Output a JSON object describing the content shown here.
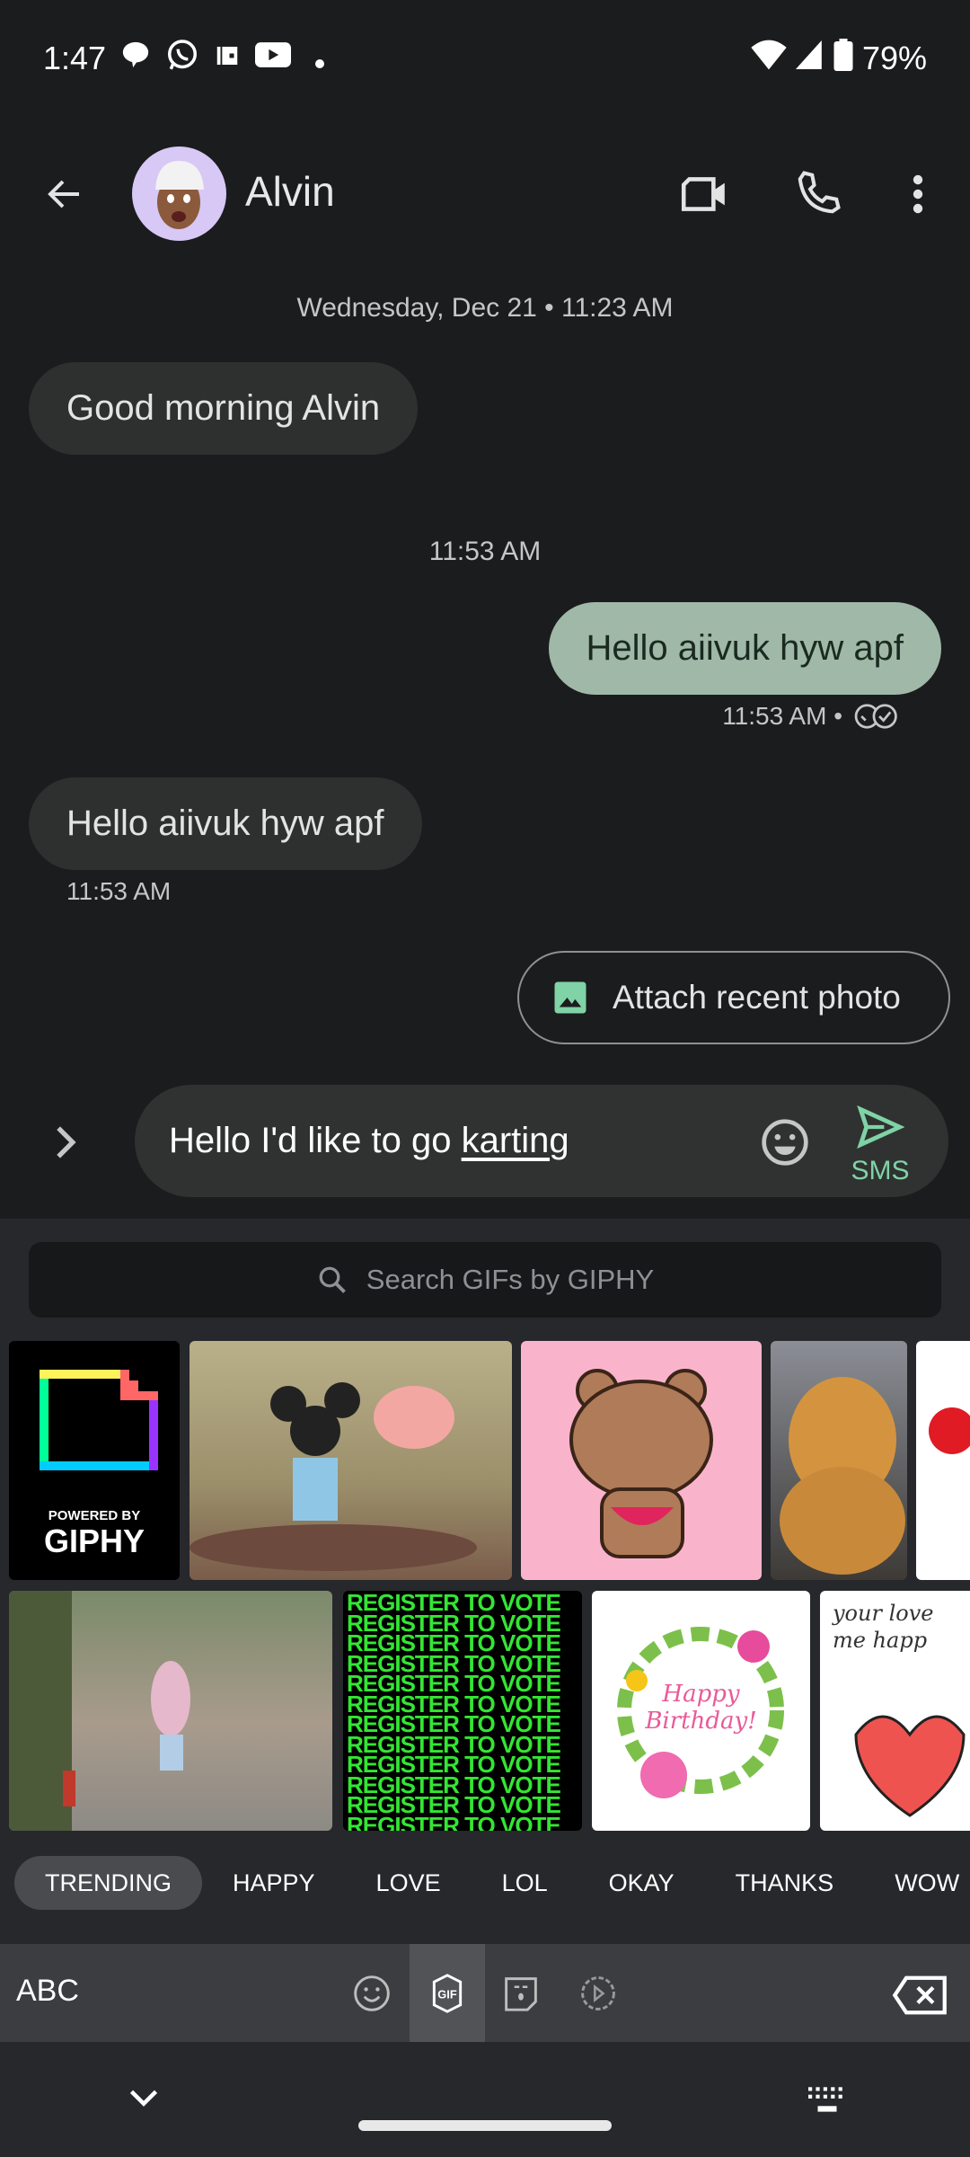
{
  "status_bar": {
    "time": "1:47",
    "battery": "79%",
    "icons": [
      "chat-bubble-icon",
      "whatsapp-icon",
      "wallet-icon",
      "youtube-icon",
      "dot-icon",
      "wifi-icon",
      "signal-icon",
      "battery-icon"
    ]
  },
  "header": {
    "contact_name": "Alvin",
    "icons": [
      "back-arrow-icon",
      "video-call-icon",
      "phone-icon",
      "more-vert-icon"
    ]
  },
  "conversation": {
    "date_divider": "Wednesday, Dec 21 • 11:23 AM",
    "messages": [
      {
        "direction": "incoming",
        "text": "Good morning Alvin"
      },
      {
        "direction": "divider",
        "text": "11:53 AM"
      },
      {
        "direction": "outgoing",
        "text": "Hello aiivuk hyw apf",
        "meta": "11:53 AM •"
      },
      {
        "direction": "incoming",
        "text": "Hello aiivuk hyw apf",
        "meta": "11:53 AM"
      }
    ]
  },
  "suggestion": {
    "label": "Attach recent photo"
  },
  "compose": {
    "text_before": "Hello I'd like to go ",
    "text_underlined": "karting",
    "send_label": "SMS"
  },
  "gif_panel": {
    "search_placeholder": "Search GIFs by GIPHY",
    "giphy_logo": {
      "top": "POWERED BY",
      "bottom": "GIPHY"
    },
    "register_text": "REGISTER TO VOTE",
    "birthday_text": "Happy Birthday!",
    "love_text": "your love me happ",
    "categories": [
      "TRENDING",
      "HAPPY",
      "LOVE",
      "LOL",
      "OKAY",
      "THANKS",
      "WOW"
    ],
    "selected_category": "TRENDING"
  },
  "keyboard_toolbar": {
    "abc_label": "ABC",
    "selected_tab": "gif"
  },
  "colors": {
    "background": "#1b1c1d",
    "outgoing_bubble": "#a0b8a8",
    "incoming_bubble": "#2e302f",
    "accent_green": "#7fd3a6"
  }
}
